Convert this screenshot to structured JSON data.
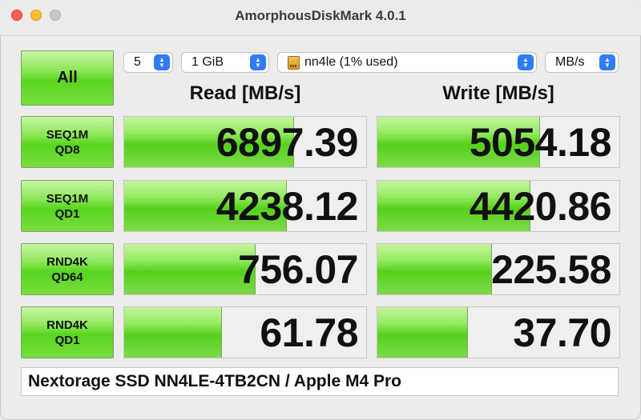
{
  "window": {
    "title": "AmorphousDiskMark 4.0.1"
  },
  "controls": {
    "all_label": "All",
    "count": "5",
    "size": "1 GiB",
    "drive": "nn4le (1% used)",
    "unit": "MB/s"
  },
  "headers": {
    "read": "Read [MB/s]",
    "write": "Write [MB/s]"
  },
  "rows": [
    {
      "line1": "SEQ1M",
      "line2": "QD8",
      "read": "6897.39",
      "write": "5054.18",
      "read_fill": 0.7,
      "write_fill": 0.67
    },
    {
      "line1": "SEQ1M",
      "line2": "QD1",
      "read": "4238.12",
      "write": "4420.86",
      "read_fill": 0.67,
      "write_fill": 0.63
    },
    {
      "line1": "RND4K",
      "line2": "QD64",
      "read": "756.07",
      "write": "225.58",
      "read_fill": 0.54,
      "write_fill": 0.47
    },
    {
      "line1": "RND4K",
      "line2": "QD1",
      "read": "61.78",
      "write": "37.70",
      "read_fill": 0.4,
      "write_fill": 0.37
    }
  ],
  "footer": {
    "text": "Nextorage SSD NN4LE-4TB2CN / Apple M4 Pro"
  },
  "colors": {
    "close": "#ff5f57",
    "minimize": "#febc2e",
    "zoom": "#c8c8c8",
    "bar_green": "#55d11b",
    "stepper_blue": "#2f7cf6"
  }
}
